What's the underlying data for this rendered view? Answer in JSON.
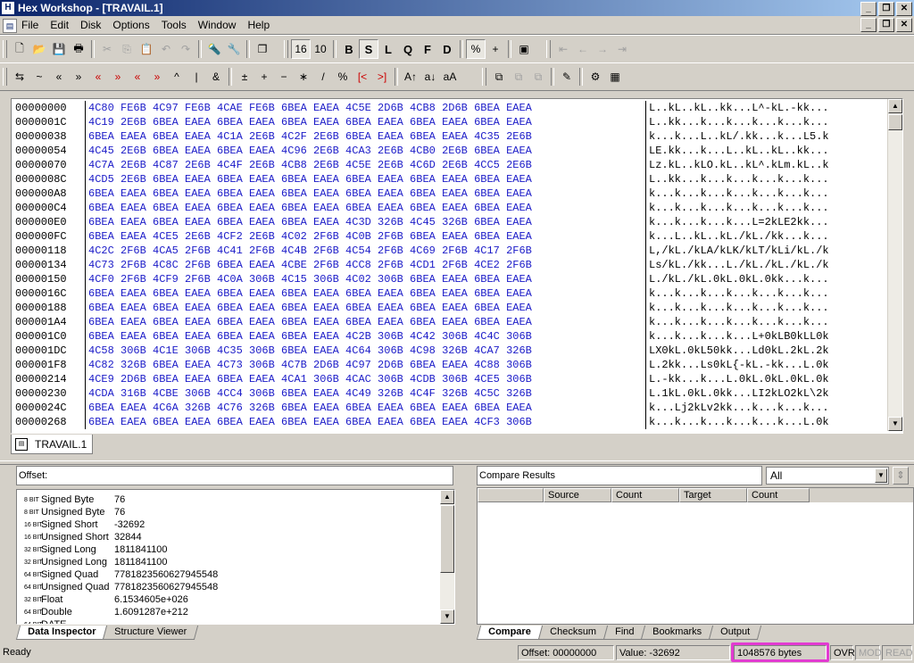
{
  "window": {
    "title": "Hex Workshop - [TRAVAIL.1]",
    "app_icon": "H"
  },
  "menu": [
    "File",
    "Edit",
    "Disk",
    "Options",
    "Tools",
    "Window",
    "Help"
  ],
  "hex_rows": [
    {
      "offset": "00000000",
      "hex": "4C80 FE6B 4C97 FE6B 4CAE FE6B 6BEA EAEA 4C5E 2D6B 4CB8 2D6B 6BEA EAEA",
      "ascii": "L..kL..kL..kk...L^-kL.-kk..."
    },
    {
      "offset": "0000001C",
      "hex": "4C19 2E6B 6BEA EAEA 6BEA EAEA 6BEA EAEA 6BEA EAEA 6BEA EAEA 6BEA EAEA",
      "ascii": "L..kk...k...k...k...k...k..."
    },
    {
      "offset": "00000038",
      "hex": "6BEA EAEA 6BEA EAEA 4C1A 2E6B 4C2F 2E6B 6BEA EAEA 6BEA EAEA 4C35 2E6B",
      "ascii": "k...k...L..kL/.kk...k...L5.k"
    },
    {
      "offset": "00000054",
      "hex": "4C45 2E6B 6BEA EAEA 6BEA EAEA 4C96 2E6B 4CA3 2E6B 4CB0 2E6B 6BEA EAEA",
      "ascii": "LE.kk...k...L..kL..kL..kk..."
    },
    {
      "offset": "00000070",
      "hex": "4C7A 2E6B 4C87 2E6B 4C4F 2E6B 4CB8 2E6B 4C5E 2E6B 4C6D 2E6B 4CC5 2E6B",
      "ascii": "Lz.kL..kLO.kL..kL^.kLm.kL..k"
    },
    {
      "offset": "0000008C",
      "hex": "4CD5 2E6B 6BEA EAEA 6BEA EAEA 6BEA EAEA 6BEA EAEA 6BEA EAEA 6BEA EAEA",
      "ascii": "L..kk...k...k...k...k...k..."
    },
    {
      "offset": "000000A8",
      "hex": "6BEA EAEA 6BEA EAEA 6BEA EAEA 6BEA EAEA 6BEA EAEA 6BEA EAEA 6BEA EAEA",
      "ascii": "k...k...k...k...k...k...k..."
    },
    {
      "offset": "000000C4",
      "hex": "6BEA EAEA 6BEA EAEA 6BEA EAEA 6BEA EAEA 6BEA EAEA 6BEA EAEA 6BEA EAEA",
      "ascii": "k...k...k...k...k...k...k..."
    },
    {
      "offset": "000000E0",
      "hex": "6BEA EAEA 6BEA EAEA 6BEA EAEA 6BEA EAEA 4C3D 326B 4C45 326B 6BEA EAEA",
      "ascii": "k...k...k...k...L=2kLE2kk..."
    },
    {
      "offset": "000000FC",
      "hex": "6BEA EAEA 4CE5 2E6B 4CF2 2E6B 4C02 2F6B 4C0B 2F6B 6BEA EAEA 6BEA EAEA",
      "ascii": "k...L..kL..kL./kL./kk...k..."
    },
    {
      "offset": "00000118",
      "hex": "4C2C 2F6B 4CA5 2F6B 4C41 2F6B 4C4B 2F6B 4C54 2F6B 4C69 2F6B 4C17 2F6B",
      "ascii": "L,/kL./kLA/kLK/kLT/kLi/kL./k"
    },
    {
      "offset": "00000134",
      "hex": "4C73 2F6B 4C8C 2F6B 6BEA EAEA 4CBE 2F6B 4CC8 2F6B 4CD1 2F6B 4CE2 2F6B",
      "ascii": "Ls/kL./kk...L./kL./kL./kL./k"
    },
    {
      "offset": "00000150",
      "hex": "4CF0 2F6B 4CF9 2F6B 4C0A 306B 4C15 306B 4C02 306B 6BEA EAEA 6BEA EAEA",
      "ascii": "L./kL./kL.0kL.0kL.0kk...k..."
    },
    {
      "offset": "0000016C",
      "hex": "6BEA EAEA 6BEA EAEA 6BEA EAEA 6BEA EAEA 6BEA EAEA 6BEA EAEA 6BEA EAEA",
      "ascii": "k...k...k...k...k...k...k..."
    },
    {
      "offset": "00000188",
      "hex": "6BEA EAEA 6BEA EAEA 6BEA EAEA 6BEA EAEA 6BEA EAEA 6BEA EAEA 6BEA EAEA",
      "ascii": "k...k...k...k...k...k...k..."
    },
    {
      "offset": "000001A4",
      "hex": "6BEA EAEA 6BEA EAEA 6BEA EAEA 6BEA EAEA 6BEA EAEA 6BEA EAEA 6BEA EAEA",
      "ascii": "k...k...k...k...k...k...k..."
    },
    {
      "offset": "000001C0",
      "hex": "6BEA EAEA 6BEA EAEA 6BEA EAEA 6BEA EAEA 4C2B 306B 4C42 306B 4C4C 306B",
      "ascii": "k...k...k...k...L+0kLB0kLL0k"
    },
    {
      "offset": "000001DC",
      "hex": "4C58 306B 4C1E 306B 4C35 306B 6BEA EAEA 4C64 306B 4C98 326B 4CA7 326B",
      "ascii": "LX0kL.0kL50kk...Ld0kL.2kL.2k"
    },
    {
      "offset": "000001F8",
      "hex": "4C82 326B 6BEA EAEA 4C73 306B 4C7B 2D6B 4C97 2D6B 6BEA EAEA 4C88 306B",
      "ascii": "L.2kk...Ls0kL{-kL.-kk...L.0k"
    },
    {
      "offset": "00000214",
      "hex": "4CE9 2D6B 6BEA EAEA 6BEA EAEA 4CA1 306B 4CAC 306B 4CDB 306B 4CE5 306B",
      "ascii": "L.-kk...k...L.0kL.0kL.0kL.0k"
    },
    {
      "offset": "00000230",
      "hex": "4CDA 316B 4CBE 306B 4CC4 306B 6BEA EAEA 4C49 326B 4C4F 326B 4C5C 326B",
      "ascii": "L.1kL.0kL.0kk...LI2kLO2kL\\2k"
    },
    {
      "offset": "0000024C",
      "hex": "6BEA EAEA 4C6A 326B 4C76 326B 6BEA EAEA 6BEA EAEA 6BEA EAEA 6BEA EAEA",
      "ascii": "k...Lj2kLv2kk...k...k...k..."
    },
    {
      "offset": "00000268",
      "hex": "6BEA EAEA 6BEA EAEA 6BEA EAEA 6BEA EAEA 6BEA EAEA 6BEA EAEA 4CF3 306B",
      "ascii": "k...k...k...k...k...k...L.0k"
    }
  ],
  "doc_tab": "TRAVAIL.1",
  "inspector": {
    "offset_label": "Offset:",
    "rows": [
      {
        "bits": "8 BIT",
        "name": "Signed Byte",
        "value": "76"
      },
      {
        "bits": "8 BIT",
        "name": "Unsigned Byte",
        "value": "76"
      },
      {
        "bits": "16 BIT",
        "name": "Signed Short",
        "value": "-32692"
      },
      {
        "bits": "16 BIT",
        "name": "Unsigned Short",
        "value": "32844"
      },
      {
        "bits": "32 BIT",
        "name": "Signed Long",
        "value": "1811841100"
      },
      {
        "bits": "32 BIT",
        "name": "Unsigned Long",
        "value": "1811841100"
      },
      {
        "bits": "64 BIT",
        "name": "Signed Quad",
        "value": "7781823560627945548"
      },
      {
        "bits": "64 BIT",
        "name": "Unsigned Quad",
        "value": "7781823560627945548"
      },
      {
        "bits": "32 BIT",
        "name": "Float",
        "value": "6.1534605e+026"
      },
      {
        "bits": "64 BIT",
        "name": "Double",
        "value": "1.6091287e+212"
      },
      {
        "bits": "64 BIT",
        "name": "DATE",
        "value": ""
      }
    ],
    "tabs": [
      "Data Inspector",
      "Structure Viewer"
    ]
  },
  "compare": {
    "header": "Compare Results",
    "filter": "All",
    "columns": [
      "Source",
      "Count",
      "Target",
      "Count"
    ],
    "tabs": [
      "Compare",
      "Checksum",
      "Find",
      "Bookmarks",
      "Output"
    ]
  },
  "status": {
    "ready": "Ready",
    "offset": "Offset: 00000000",
    "value": "Value: -32692",
    "size": "1048576 bytes",
    "ovr": "OVR",
    "mod": "MOD",
    "read": "READ"
  },
  "colors": {
    "hex_text": "#1a1ac8",
    "highlight": "#e23bd1"
  }
}
